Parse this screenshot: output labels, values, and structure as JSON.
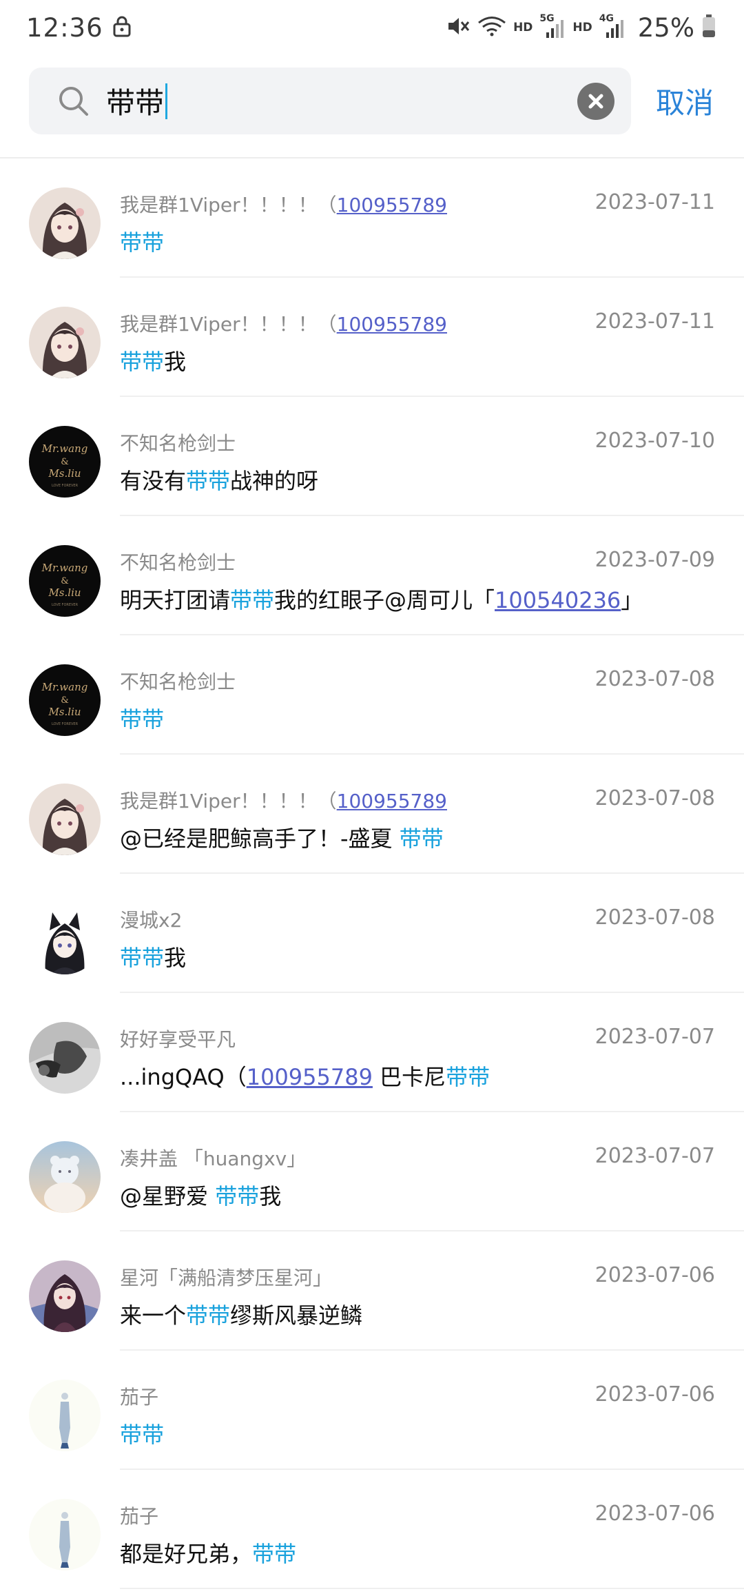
{
  "status_bar": {
    "time": "12:36",
    "hd1": "HD",
    "net1": "5G",
    "hd2": "HD",
    "net2": "4G",
    "battery": "25%",
    "icons": [
      "lock-icon",
      "mute-icon",
      "wifi-icon",
      "signal-icon",
      "battery-icon"
    ]
  },
  "search": {
    "value": "带带",
    "cancel_label": "取消"
  },
  "results": [
    {
      "avatar": "anime-girl",
      "name_text": "我是群1Viper！！！！（",
      "name_link": "100955789",
      "date": "2023-07-11",
      "msg": [
        {
          "t": "带带",
          "s": "hl"
        }
      ]
    },
    {
      "avatar": "anime-girl",
      "name_text": "我是群1Viper！！！！（",
      "name_link": "100955789",
      "date": "2023-07-11",
      "msg": [
        {
          "t": "带带",
          "s": "hl"
        },
        {
          "t": "我",
          "s": ""
        }
      ]
    },
    {
      "avatar": "black-logo",
      "name_text": "不知名枪剑士",
      "name_link": "",
      "date": "2023-07-10",
      "msg": [
        {
          "t": "有没有",
          "s": ""
        },
        {
          "t": "带带",
          "s": "hl"
        },
        {
          "t": "战神的呀",
          "s": ""
        }
      ]
    },
    {
      "avatar": "black-logo",
      "name_text": "不知名枪剑士",
      "name_link": "",
      "date": "2023-07-09",
      "msg": [
        {
          "t": "明天打团请",
          "s": ""
        },
        {
          "t": "带带",
          "s": "hl"
        },
        {
          "t": "我的红眼子@周可儿「",
          "s": ""
        },
        {
          "t": "100540236",
          "s": "lnk"
        },
        {
          "t": "」",
          "s": ""
        }
      ]
    },
    {
      "avatar": "black-logo",
      "name_text": "不知名枪剑士",
      "name_link": "",
      "date": "2023-07-08",
      "msg": [
        {
          "t": "带带",
          "s": "hl"
        }
      ]
    },
    {
      "avatar": "anime-girl",
      "name_text": "我是群1Viper！！！！（",
      "name_link": "100955789",
      "date": "2023-07-08",
      "msg": [
        {
          "t": "@已经是肥鲸高手了！-盛夏 ",
          "s": ""
        },
        {
          "t": "带带",
          "s": "hl"
        }
      ]
    },
    {
      "avatar": "cat-girl",
      "name_text": "漫城x2",
      "name_link": "",
      "date": "2023-07-08",
      "msg": [
        {
          "t": "带带",
          "s": "hl"
        },
        {
          "t": "我",
          "s": ""
        }
      ]
    },
    {
      "avatar": "bw-photo",
      "name_text": "好好享受平凡",
      "name_link": "",
      "date": "2023-07-07",
      "msg": [
        {
          "t": "...ingQAQ（",
          "s": ""
        },
        {
          "t": "100955789",
          "s": "lnk"
        },
        {
          "t": " 巴卡尼",
          "s": ""
        },
        {
          "t": "带带",
          "s": "hl"
        }
      ]
    },
    {
      "avatar": "sky-bear",
      "name_text": "凑井盖 「huangxv」",
      "name_link": "",
      "date": "2023-07-07",
      "msg": [
        {
          "t": "@星野爱 ",
          "s": ""
        },
        {
          "t": "带带",
          "s": "hl"
        },
        {
          "t": "我",
          "s": ""
        }
      ]
    },
    {
      "avatar": "dark-anime",
      "name_text": "星河「满船清梦压星河」",
      "name_link": "",
      "date": "2023-07-06",
      "msg": [
        {
          "t": "来一个",
          "s": ""
        },
        {
          "t": "带带",
          "s": "hl"
        },
        {
          "t": "缪斯风暴逆鳞",
          "s": ""
        }
      ]
    },
    {
      "avatar": "pale-figure",
      "name_text": "茄子",
      "name_link": "",
      "date": "2023-07-06",
      "msg": [
        {
          "t": "带带",
          "s": "hl"
        }
      ]
    },
    {
      "avatar": "pale-figure",
      "name_text": "茄子",
      "name_link": "",
      "date": "2023-07-06",
      "msg": [
        {
          "t": "都是好兄弟，",
          "s": ""
        },
        {
          "t": "带带",
          "s": "hl"
        }
      ]
    }
  ],
  "avatar_images": {
    "anime-girl": "avatar-anime-girl-image",
    "black-logo": "avatar-black-logo-image",
    "cat-girl": "avatar-cat-girl-image",
    "bw-photo": "avatar-photo-image",
    "sky-bear": "avatar-sky-image",
    "dark-anime": "avatar-dark-anime-image",
    "pale-figure": "avatar-pale-figure-image"
  },
  "logo_text": {
    "black-logo": [
      "Mr.wang",
      "&",
      "Ms.liu",
      "LOVE FOREVER"
    ]
  },
  "colors": {
    "highlight": "#1aa2dd",
    "link": "#5560c9",
    "cancel": "#2a83d8",
    "secondary_text": "#8a8a8a"
  }
}
